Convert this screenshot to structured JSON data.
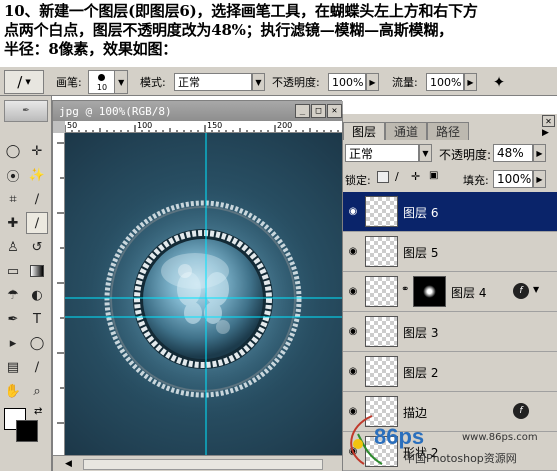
{
  "instructions": {
    "line1": "10、新建一个图层(即图层6)，选择画笔工具，在蝴蝶头左上方和右下方",
    "line2": "点两个白点，图层不透明度改为48%；执行滤镜—模糊—高斯模糊，",
    "line3": "半径：8像素，效果如图："
  },
  "options_bar": {
    "brush_label": "画笔:",
    "brush_size": "10",
    "mode_label": "模式:",
    "mode_value": "正常",
    "opacity_label": "不透明度:",
    "opacity_value": "100%",
    "flow_label": "流量:",
    "flow_value": "100%"
  },
  "document": {
    "title": "jpg @ 100%(RGB/8)",
    "ruler_ticks": [
      "50",
      "100",
      "150",
      "200",
      "250"
    ]
  },
  "layers_panel": {
    "tabs": [
      "图层",
      "通道",
      "路径"
    ],
    "blend_mode": "正常",
    "opacity_label": "不透明度:",
    "opacity_value": "48%",
    "lock_label": "锁定:",
    "fill_label": "填充:",
    "fill_value": "100%",
    "layers": [
      {
        "name": "图层 6",
        "selected": true
      },
      {
        "name": "图层 5",
        "selected": false
      },
      {
        "name": "图层 4",
        "selected": false
      },
      {
        "name": "图层 3",
        "selected": false
      },
      {
        "name": "图层 2",
        "selected": false
      },
      {
        "name": "描边",
        "selected": false
      },
      {
        "name": "形状 2",
        "selected": false
      }
    ]
  },
  "watermark": {
    "brand": "86ps",
    "url": "www.86ps.com",
    "text": "中国Photoshop资源网"
  },
  "colors": {
    "selected_layer": "#0a246a",
    "guide": "#00e5ff",
    "canvas": "#2b5469"
  }
}
